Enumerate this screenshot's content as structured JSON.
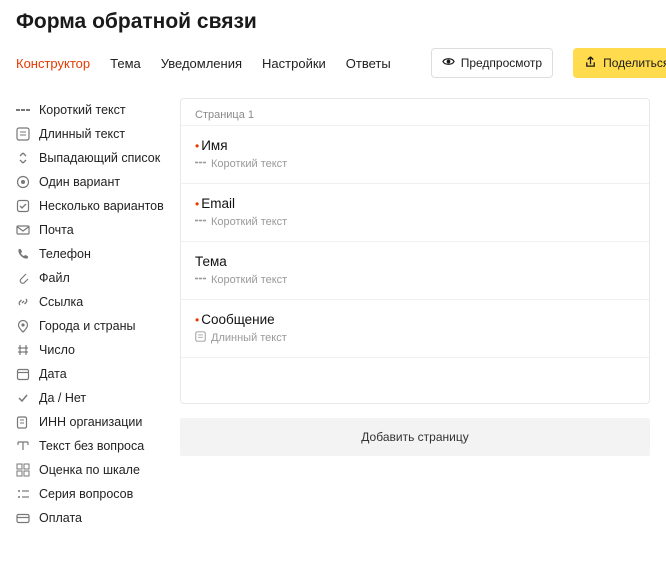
{
  "header": {
    "title": "Форма обратной связи"
  },
  "tabs": {
    "constructor": "Конструктор",
    "theme": "Тема",
    "notifications": "Уведомления",
    "settings": "Настройки",
    "answers": "Ответы"
  },
  "toolbar": {
    "preview": "Предпросмотр",
    "share": "Поделиться",
    "more": "···"
  },
  "sidebar": {
    "items": [
      {
        "label": "Короткий текст"
      },
      {
        "label": "Длинный текст"
      },
      {
        "label": "Выпадающий список"
      },
      {
        "label": "Один вариант"
      },
      {
        "label": "Несколько вариантов"
      },
      {
        "label": "Почта"
      },
      {
        "label": "Телефон"
      },
      {
        "label": "Файл"
      },
      {
        "label": "Ссылка"
      },
      {
        "label": "Города и страны"
      },
      {
        "label": "Число"
      },
      {
        "label": "Дата"
      },
      {
        "label": "Да / Нет"
      },
      {
        "label": "ИНН организации"
      },
      {
        "label": "Текст без вопроса"
      },
      {
        "label": "Оценка по шкале"
      },
      {
        "label": "Серия вопросов"
      },
      {
        "label": "Оплата"
      }
    ]
  },
  "page": {
    "label": "Страница 1",
    "fields": [
      {
        "title": "Имя",
        "type": "Короткий текст",
        "required": true
      },
      {
        "title": "Email",
        "type": "Короткий текст",
        "required": true
      },
      {
        "title": "Тема",
        "type": "Короткий текст",
        "required": false
      },
      {
        "title": "Сообщение",
        "type": "Длинный текст",
        "required": true
      }
    ],
    "add_page": "Добавить страницу"
  }
}
